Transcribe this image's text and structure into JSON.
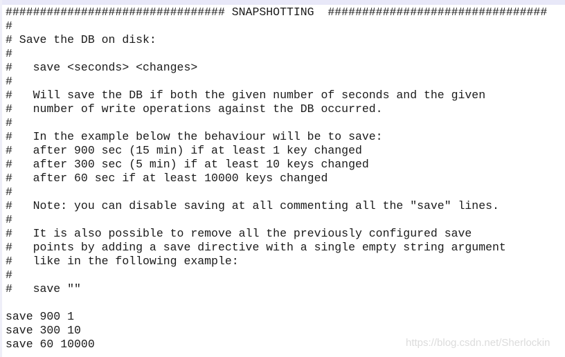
{
  "editor": {
    "lines": [
      "################################ SNAPSHOTTING  ################################",
      "#",
      "# Save the DB on disk:",
      "#",
      "#   save <seconds> <changes>",
      "#",
      "#   Will save the DB if both the given number of seconds and the given",
      "#   number of write operations against the DB occurred.",
      "#",
      "#   In the example below the behaviour will be to save:",
      "#   after 900 sec (15 min) if at least 1 key changed",
      "#   after 300 sec (5 min) if at least 10 keys changed",
      "#   after 60 sec if at least 10000 keys changed",
      "#",
      "#   Note: you can disable saving at all commenting all the \"save\" lines.",
      "#",
      "#   It is also possible to remove all the previously configured save",
      "#   points by adding a save directive with a single empty string argument",
      "#   like in the following example:",
      "#",
      "#   save \"\"",
      "",
      "save 900 1",
      "save 300 10",
      "save 60 10000"
    ]
  },
  "watermark": "https://blog.csdn.net/Sherlockin"
}
